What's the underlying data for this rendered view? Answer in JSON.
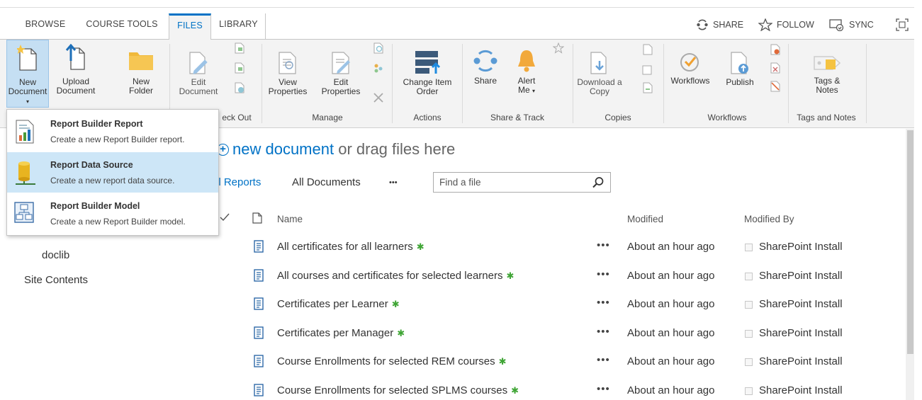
{
  "tabs": [
    "BROWSE",
    "COURSE TOOLS",
    "FILES",
    "LIBRARY"
  ],
  "actions": {
    "share": "SHARE",
    "follow": "FOLLOW",
    "sync": "SYNC"
  },
  "ribbon": {
    "new_document": [
      "New",
      "Document"
    ],
    "upload_document": [
      "Upload",
      "Document"
    ],
    "new_folder": [
      "New",
      "Folder"
    ],
    "edit_document": [
      "Edit",
      "Document"
    ],
    "check_out_group": "eck Out",
    "view_properties": [
      "View",
      "Properties"
    ],
    "edit_properties": [
      "Edit",
      "Properties"
    ],
    "manage_group": "Manage",
    "change_item_order": [
      "Change Item",
      "Order"
    ],
    "actions_group": "Actions",
    "share": "Share",
    "alert_me": [
      "Alert",
      "Me"
    ],
    "share_track_group": "Share & Track",
    "download_copy": [
      "Download a",
      "Copy"
    ],
    "copies_group": "Copies",
    "workflows": "Workflows",
    "publish": "Publish",
    "workflows_group": "Workflows",
    "tags_notes": [
      "Tags &",
      "Notes"
    ],
    "tags_notes_group": "Tags and Notes"
  },
  "menu": [
    {
      "title": "Report Builder Report",
      "desc": "Create a new Report Builder report.",
      "icon": "report-icon",
      "highlighted": false
    },
    {
      "title": "Report Data Source",
      "desc": "Create a new report data source.",
      "icon": "data-source-icon",
      "highlighted": true
    },
    {
      "title": "Report Builder Model",
      "desc": "Create a new Report Builder model.",
      "icon": "model-icon",
      "highlighted": false
    }
  ],
  "nav": {
    "doclib": "doclib",
    "site_contents": "Site Contents"
  },
  "main": {
    "new_doc_link": "new document",
    "new_doc_rest": " or drag files here",
    "view_all_reports": "ll Reports",
    "view_all_documents": "All Documents",
    "more": "•••",
    "search_placeholder": "Find a file"
  },
  "columns": {
    "name": "Name",
    "modified": "Modified",
    "modified_by": "Modified By"
  },
  "rows": [
    {
      "name": "All certificates for all learners",
      "modified": "About an hour ago",
      "by": "SharePoint Install"
    },
    {
      "name": "All courses and certificates for selected learners",
      "modified": "About an hour ago",
      "by": "SharePoint Install"
    },
    {
      "name": "Certificates per Learner",
      "modified": "About an hour ago",
      "by": "SharePoint Install"
    },
    {
      "name": "Certificates per Manager",
      "modified": "About an hour ago",
      "by": "SharePoint Install"
    },
    {
      "name": "Course Enrollments for selected REM courses",
      "modified": "About an hour ago",
      "by": "SharePoint Install"
    },
    {
      "name": "Course Enrollments for selected SPLMS courses",
      "modified": "About an hour ago",
      "by": "SharePoint Install"
    }
  ],
  "new_marker": "✱",
  "colors": {
    "accent": "#0072c6",
    "ribbon_bg": "#f3f3f3",
    "menu_highlight": "#cde6f7",
    "new_marker": "#3fa535"
  }
}
